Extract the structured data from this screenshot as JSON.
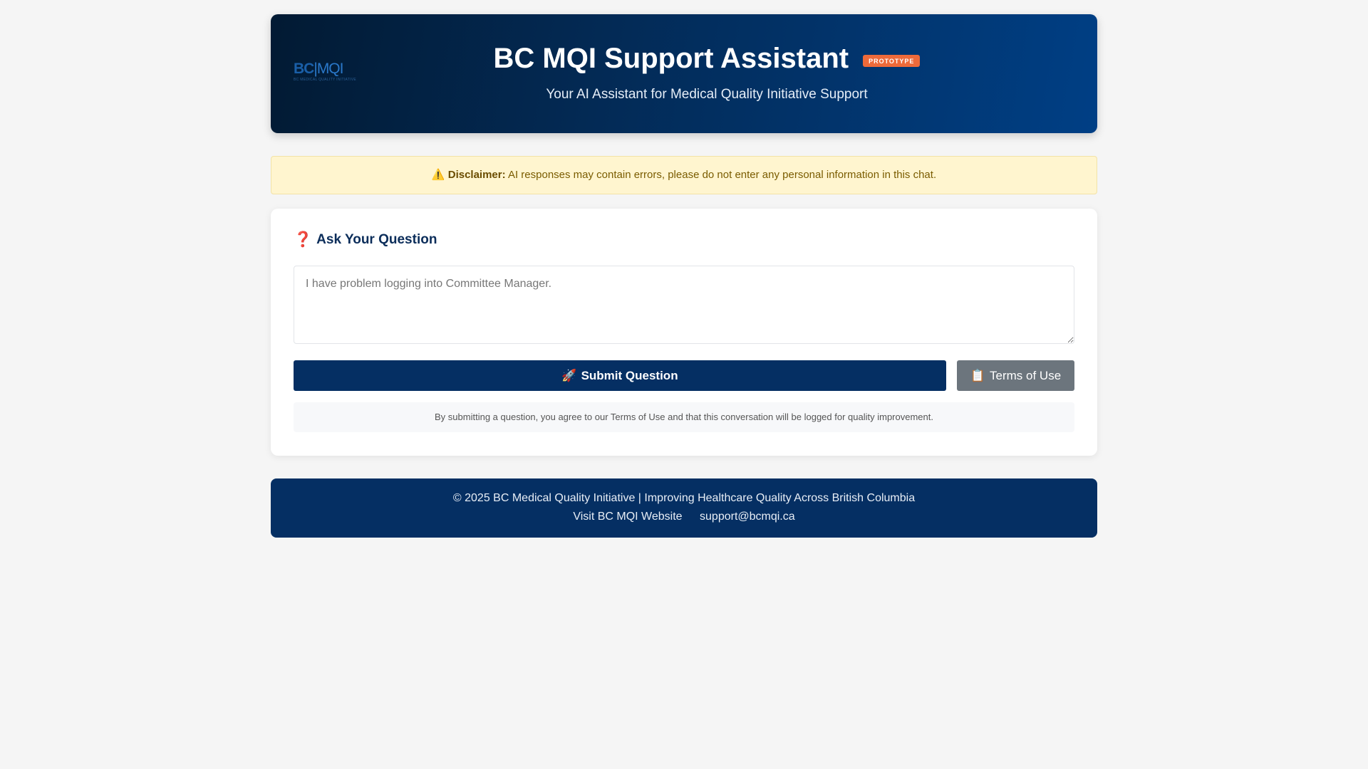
{
  "header": {
    "logo": {
      "bc": "BC",
      "mqi": "MQI",
      "tagline": "BC MEDICAL QUALITY INITIATIVE"
    },
    "title": "BC MQI Support Assistant",
    "badge": "PROTOTYPE",
    "subtitle": "Your AI Assistant for Medical Quality Initiative Support",
    "colors": {
      "gradient_start": "#021a33",
      "gradient_end": "#003f85",
      "badge": "#ee6a3a"
    }
  },
  "disclaimer": {
    "icon": "⚠️",
    "label": "Disclaimer:",
    "text": "AI responses may contain errors, please do not enter any personal information in this chat."
  },
  "question_card": {
    "icon": "❓",
    "title": "Ask Your Question",
    "input": {
      "value": "",
      "placeholder": "I have problem logging into Committee Manager."
    },
    "submit_button": {
      "icon": "🚀",
      "label": "Submit Question",
      "color": "#052f63"
    },
    "terms_button": {
      "icon": "📋",
      "label": "Terms of Use",
      "color": "#6c757d"
    },
    "notice": "By submitting a question, you agree to our Terms of Use and that this conversation will be logged for quality improvement."
  },
  "footer": {
    "copyright": "© 2025 BC Medical Quality Initiative | Improving Healthcare Quality Across British Columbia",
    "links": [
      {
        "label": "Visit BC MQI Website"
      },
      {
        "label": "support@bcmqi.ca"
      }
    ],
    "color": "#052f63"
  }
}
